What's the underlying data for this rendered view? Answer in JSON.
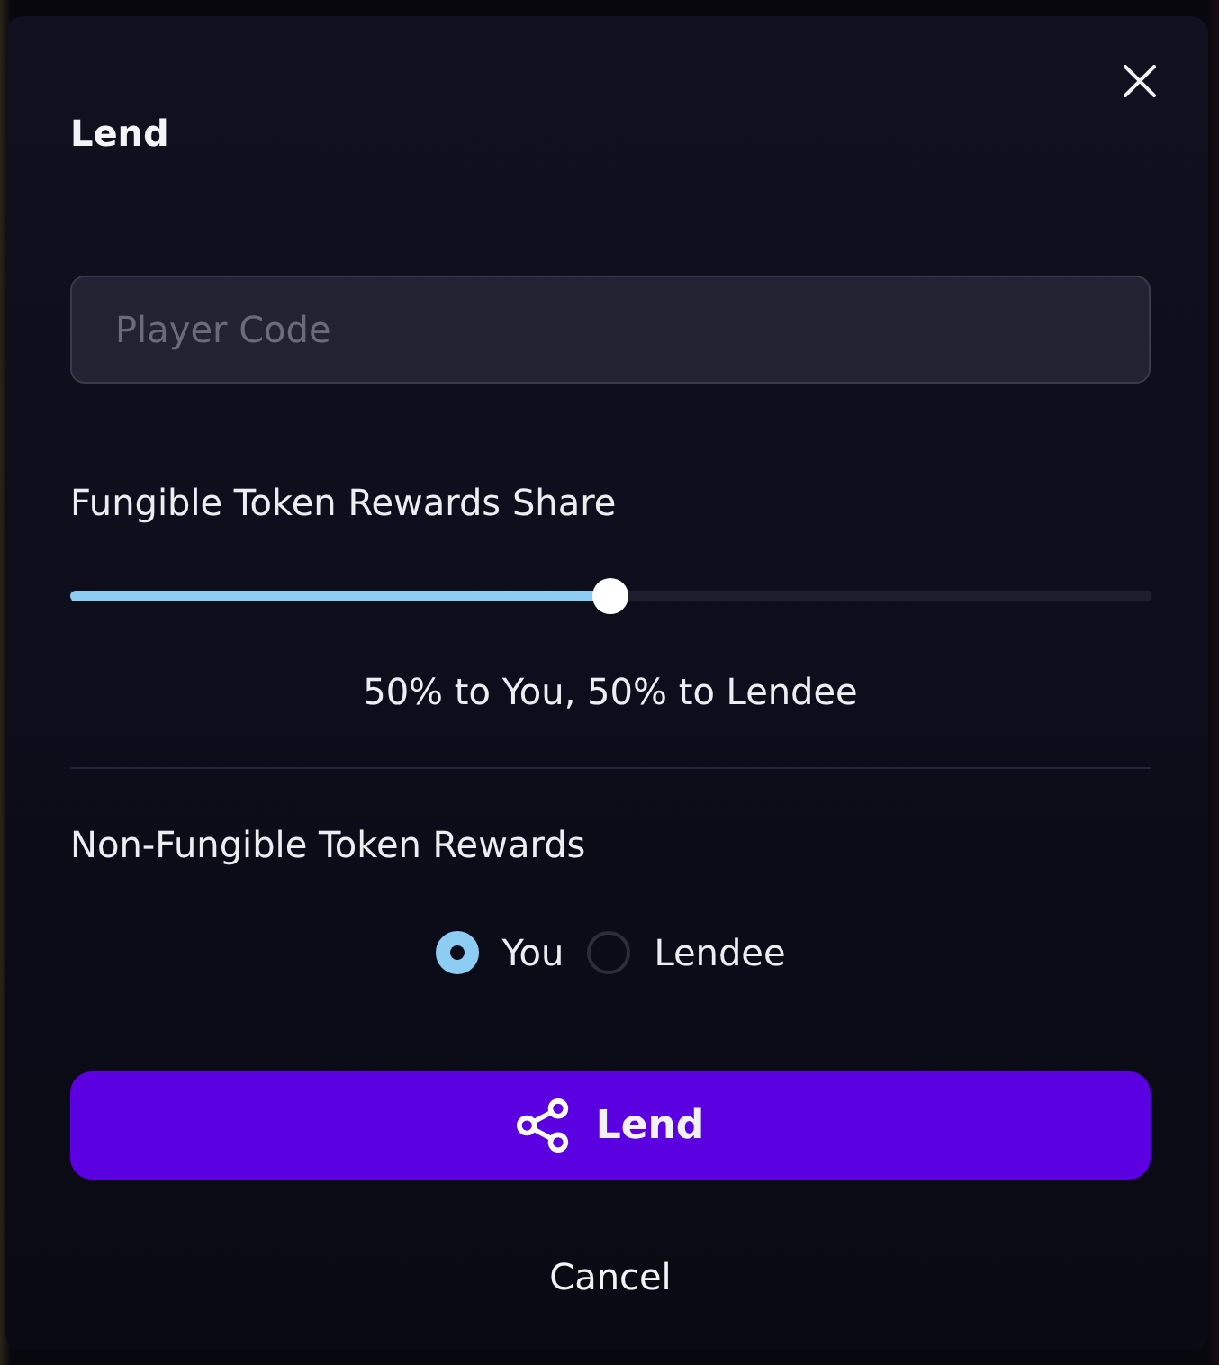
{
  "dialog": {
    "title": "Lend"
  },
  "player_code": {
    "placeholder": "Player Code"
  },
  "fungible_share": {
    "label": "Fungible Token Rewards Share",
    "level": 0.5,
    "reading": "50% to You, 50% to Lendee"
  },
  "nft_rewards": {
    "label": "Non-Fungible Token Rewards",
    "options": [
      {
        "label": "You",
        "selected": true
      },
      {
        "label": "Lendee",
        "selected": false
      }
    ]
  },
  "buttons": [
    {
      "label": "Lend",
      "kind": "primary"
    },
    {
      "label": "Cancel",
      "kind": "text"
    }
  ]
}
